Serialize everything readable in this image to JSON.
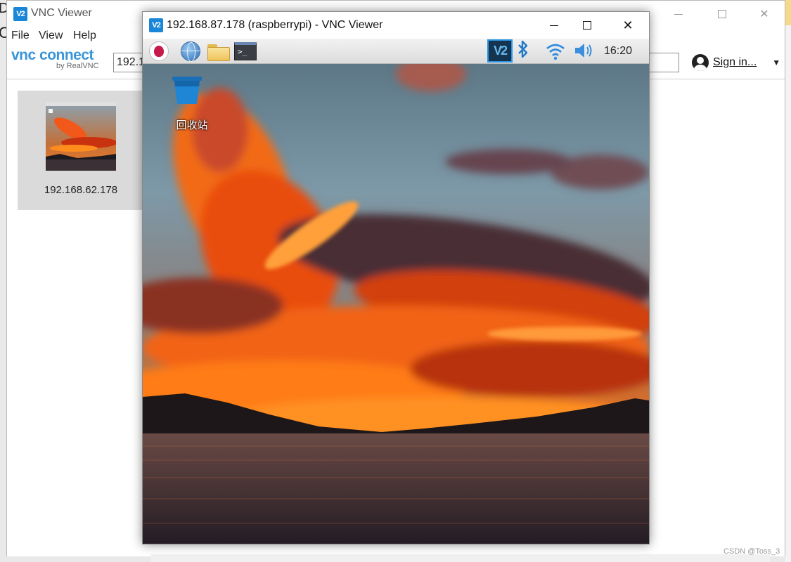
{
  "main_window": {
    "title": "VNC Viewer",
    "menu": [
      "File",
      "View",
      "Help"
    ],
    "brand": {
      "name": "vnc connect",
      "byline": "by RealVNC"
    },
    "address_value": "192.1",
    "sign_in_label": "Sign in...",
    "sign_in_caret": "▼",
    "connections": [
      {
        "label": "192.168.62.178"
      }
    ]
  },
  "remote_window": {
    "title": "192.168.87.178 (raspberrypi) - VNC Viewer",
    "panel": {
      "left_icons": [
        "raspberry-menu-icon",
        "web-browser-icon",
        "file-manager-icon",
        "terminal-icon"
      ],
      "tray_icons": [
        "vnc-server-icon",
        "bluetooth-icon",
        "wifi-icon",
        "volume-icon"
      ],
      "terminal_glyph": ">_",
      "vnc_tray_glyph": "V2",
      "clock": "16:20"
    },
    "desktop_icons": [
      {
        "label": "回收站",
        "icon": "trash-icon"
      }
    ]
  },
  "ghost_glyphs": {
    "top": "D",
    "mid": "C"
  },
  "window_controls": {
    "close": "✕"
  },
  "logo_glyph": "V2",
  "watermark": "CSDN @Toss_3",
  "colors": {
    "vnc_blue": "#1a86d8",
    "brand_blue": "#3a95d8",
    "card_selected": "#dadada",
    "sky": "#7f9fb0",
    "fire": "#f06a0e",
    "water": "#2f2a35"
  }
}
